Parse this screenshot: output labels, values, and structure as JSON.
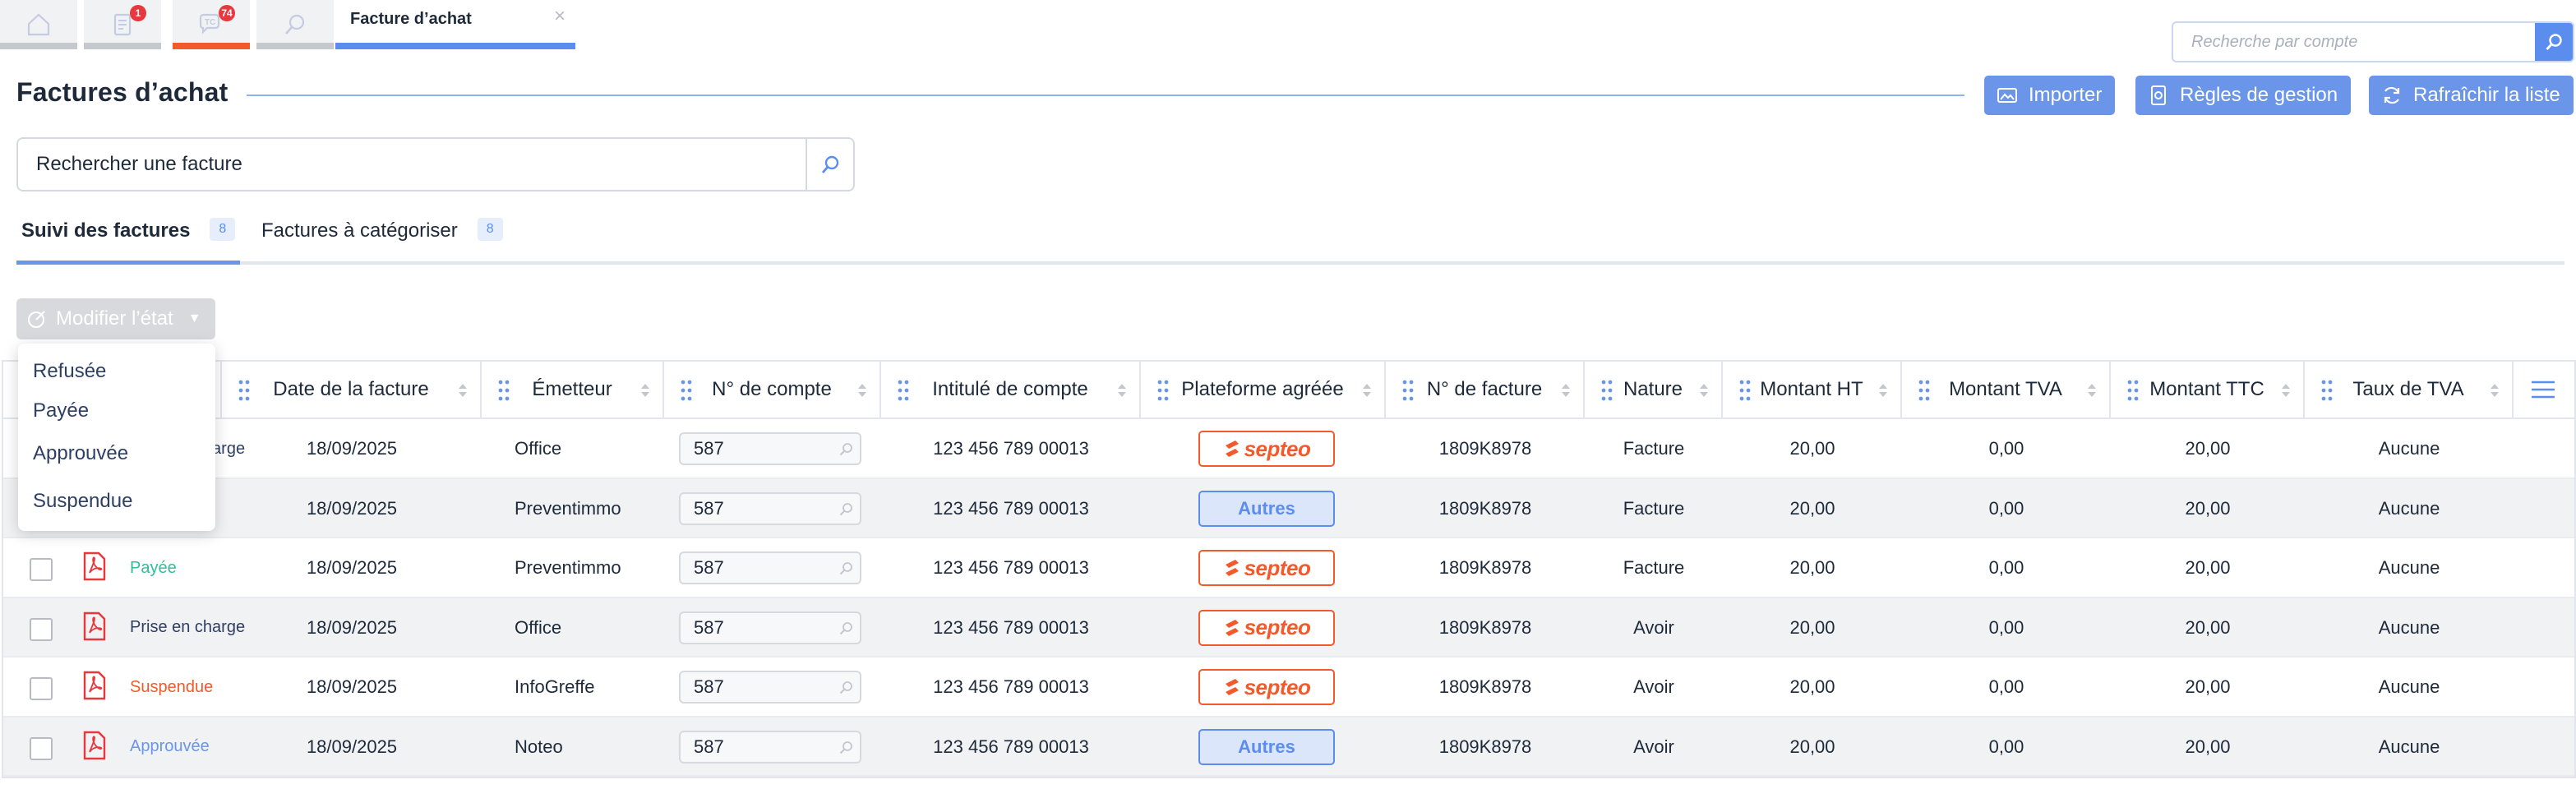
{
  "top_tabs": {
    "home_icon": "home-icon",
    "documents_badge": "1",
    "exchanges_badge": "74",
    "document_tab_label": "Facture d’achat",
    "document_tab_close": "×"
  },
  "account_search": {
    "placeholder": "Recherche par compte"
  },
  "page": {
    "title": "Factures d’achat",
    "actions": {
      "import": "Importer",
      "rules": "Règles de gestion",
      "refresh": "Rafraîchir la liste"
    }
  },
  "invoice_search": {
    "placeholder": "Rechercher une facture"
  },
  "tabs": [
    {
      "label": "Suivi des factures",
      "count": "8",
      "active": true
    },
    {
      "label": "Factures à catégoriser",
      "count": "8",
      "active": false
    }
  ],
  "state_button": {
    "label": "Modifier l’état"
  },
  "state_menu": [
    "Refusée",
    "Payée",
    "Approuvée",
    "Suspendue"
  ],
  "columns": [
    "Date de la facture",
    "Émetteur",
    "N° de compte",
    "Intitulé de compte",
    "Plateforme agréée",
    "N° de facture",
    "Nature",
    "Montant HT",
    "Montant TVA",
    "Montant TTC",
    "Taux de TVA"
  ],
  "platform_labels": {
    "septeo": "septeo",
    "autres": "Autres"
  },
  "colors": {
    "accent": "#5b8def",
    "brand_orange": "#f25a2b",
    "payee": "#2fbf9b",
    "suspendue": "#f25a2b",
    "approuvee": "#6b95e8",
    "prise": "#2e3f64"
  },
  "rows": [
    {
      "status": "Prise en charge",
      "date": "18/09/2025",
      "emitter": "Office",
      "account": "587",
      "account_label": "123 456 789 00013",
      "platform": "septeo",
      "invoice_no": "1809K8978",
      "nature": "Facture",
      "ht": "20,00",
      "tva": "0,00",
      "ttc": "20,00",
      "rate": "Aucune"
    },
    {
      "status": "",
      "date": "18/09/2025",
      "emitter": "Preventimmo",
      "account": "587",
      "account_label": "123 456 789 00013",
      "platform": "autres",
      "invoice_no": "1809K8978",
      "nature": "Facture",
      "ht": "20,00",
      "tva": "0,00",
      "ttc": "20,00",
      "rate": "Aucune"
    },
    {
      "status": "Payée",
      "date": "18/09/2025",
      "emitter": "Preventimmo",
      "account": "587",
      "account_label": "123 456 789 00013",
      "platform": "septeo",
      "invoice_no": "1809K8978",
      "nature": "Facture",
      "ht": "20,00",
      "tva": "0,00",
      "ttc": "20,00",
      "rate": "Aucune"
    },
    {
      "status": "Prise en charge",
      "date": "18/09/2025",
      "emitter": "Office",
      "account": "587",
      "account_label": "123 456 789 00013",
      "platform": "septeo",
      "invoice_no": "1809K8978",
      "nature": "Avoir",
      "ht": "20,00",
      "tva": "0,00",
      "ttc": "20,00",
      "rate": "Aucune"
    },
    {
      "status": "Suspendue",
      "date": "18/09/2025",
      "emitter": "InfoGreffe",
      "account": "587",
      "account_label": "123 456 789 00013",
      "platform": "septeo",
      "invoice_no": "1809K8978",
      "nature": "Avoir",
      "ht": "20,00",
      "tva": "0,00",
      "ttc": "20,00",
      "rate": "Aucune"
    },
    {
      "status": "Approuvée",
      "date": "18/09/2025",
      "emitter": "Noteo",
      "account": "587",
      "account_label": "123 456 789 00013",
      "platform": "autres",
      "invoice_no": "1809K8978",
      "nature": "Avoir",
      "ht": "20,00",
      "tva": "0,00",
      "ttc": "20,00",
      "rate": "Aucune"
    }
  ]
}
